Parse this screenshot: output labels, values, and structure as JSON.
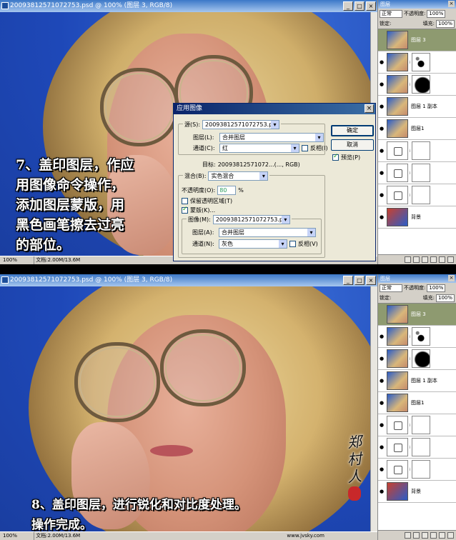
{
  "app": {
    "doc_title": "20093812571072753.psd @ 100% (图层 3, RGB/8)",
    "title_prefix": "20093812571072753.psd @ 100% (",
    "title_layer": "图层 3",
    "title_suffix": ", RGB/8)"
  },
  "window_buttons": {
    "minimize": "_",
    "maximize": "□",
    "close": "×"
  },
  "status": {
    "zoom": "100%",
    "doc_size": "文档:2.00M/13.6M",
    "url": "www.jvsky.com"
  },
  "captions": {
    "top": [
      "7、盖印图层，作应",
      "用图像命令操作，",
      "添加图层蒙版，用",
      "黑色画笔擦去过亮",
      "的部位。"
    ],
    "bottom": [
      "8、盖印图层，进行锐化和对比度处理。",
      "操作完成。"
    ]
  },
  "layers_panel": {
    "title": "图层",
    "blend_mode": "正常",
    "opacity_label": "不透明度:",
    "opacity_value": "100%",
    "lock_label": "锁定:",
    "fill_label": "填充:",
    "fill_value": "100%",
    "layers": [
      {
        "name": "图层 3",
        "type": "pixel",
        "mask": "",
        "visible": false,
        "active": true
      },
      {
        "name": "",
        "type": "pixel",
        "mask": "dots",
        "visible": true,
        "active": false
      },
      {
        "name": "",
        "type": "pixel",
        "mask": "black",
        "visible": true,
        "active": false
      },
      {
        "name": "图层 1 副本",
        "type": "pixel",
        "mask": "",
        "visible": true,
        "active": false
      },
      {
        "name": "图层1",
        "type": "pixel",
        "mask": "",
        "visible": true,
        "active": false
      },
      {
        "name": "",
        "type": "adjust",
        "mask": "white",
        "visible": true,
        "active": false
      },
      {
        "name": "",
        "type": "adjust",
        "mask": "white",
        "visible": true,
        "active": false
      },
      {
        "name": "",
        "type": "adjust",
        "mask": "white",
        "visible": true,
        "active": false
      },
      {
        "name": "背景",
        "type": "bg",
        "mask": "",
        "visible": true,
        "active": false
      }
    ]
  },
  "dialog": {
    "title": "应用图像",
    "close": "×",
    "source_label": "源(S):",
    "source_value": "20093812571072753.psd",
    "layer_label": "图层(L):",
    "layer_value": "合并图层",
    "channel_label": "通道(C):",
    "channel_value": "红",
    "invert_label": "反相(I)",
    "target_label": "目标:",
    "target_value": "20093812571072...(..., RGB)",
    "blending_label": "混合(B):",
    "blending_value": "实色混合",
    "opacity_label": "不透明度(O):",
    "opacity_value": "80",
    "percent": "%",
    "preserve_label": "保留透明区域(T)",
    "mask_label": "蒙版(K)...",
    "image_label": "图像(M):",
    "image_value": "20093812571072753.psd",
    "mask_layer_label": "图层(A):",
    "mask_layer_value": "合并图层",
    "mask_channel_label": "通道(N):",
    "mask_channel_value": "灰色",
    "mask_invert_label": "反相(V)",
    "ok": "确定",
    "cancel": "取消",
    "preview_label": "预览(P)"
  }
}
